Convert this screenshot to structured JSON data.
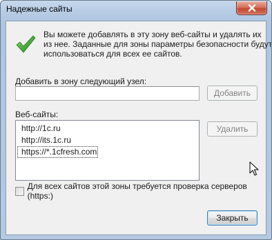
{
  "window": {
    "title": "Надежные сайты"
  },
  "info": {
    "line1": "Вы можете добавлять в эту зону  веб-сайты и удалять их",
    "line2": "из нее. Заданные для зоны параметры безопасности будут",
    "line3": "использоваться для всех ее сайтов."
  },
  "add_section": {
    "label": "Добавить в зону следующий узел:",
    "input_value": "",
    "button": "Добавить"
  },
  "sites_section": {
    "label": "Веб-сайты:",
    "items": [
      "http://1c.ru",
      "http://its.1c.ru",
      "https://*.1cfresh.com"
    ],
    "remove_button": "Удалить"
  },
  "require_https": {
    "label": "Для всех сайтов этой зоны требуется проверка серверов (https:)",
    "checked": false
  },
  "footer": {
    "close_button": "Закрыть"
  },
  "colors": {
    "check_green": "#2e9e2e",
    "close_red": "#c24a33",
    "frame_blue": "#b9cde5"
  },
  "icons": {
    "check": "checkmark-icon",
    "close": "close-icon",
    "cursor": "mouse-cursor-icon"
  }
}
